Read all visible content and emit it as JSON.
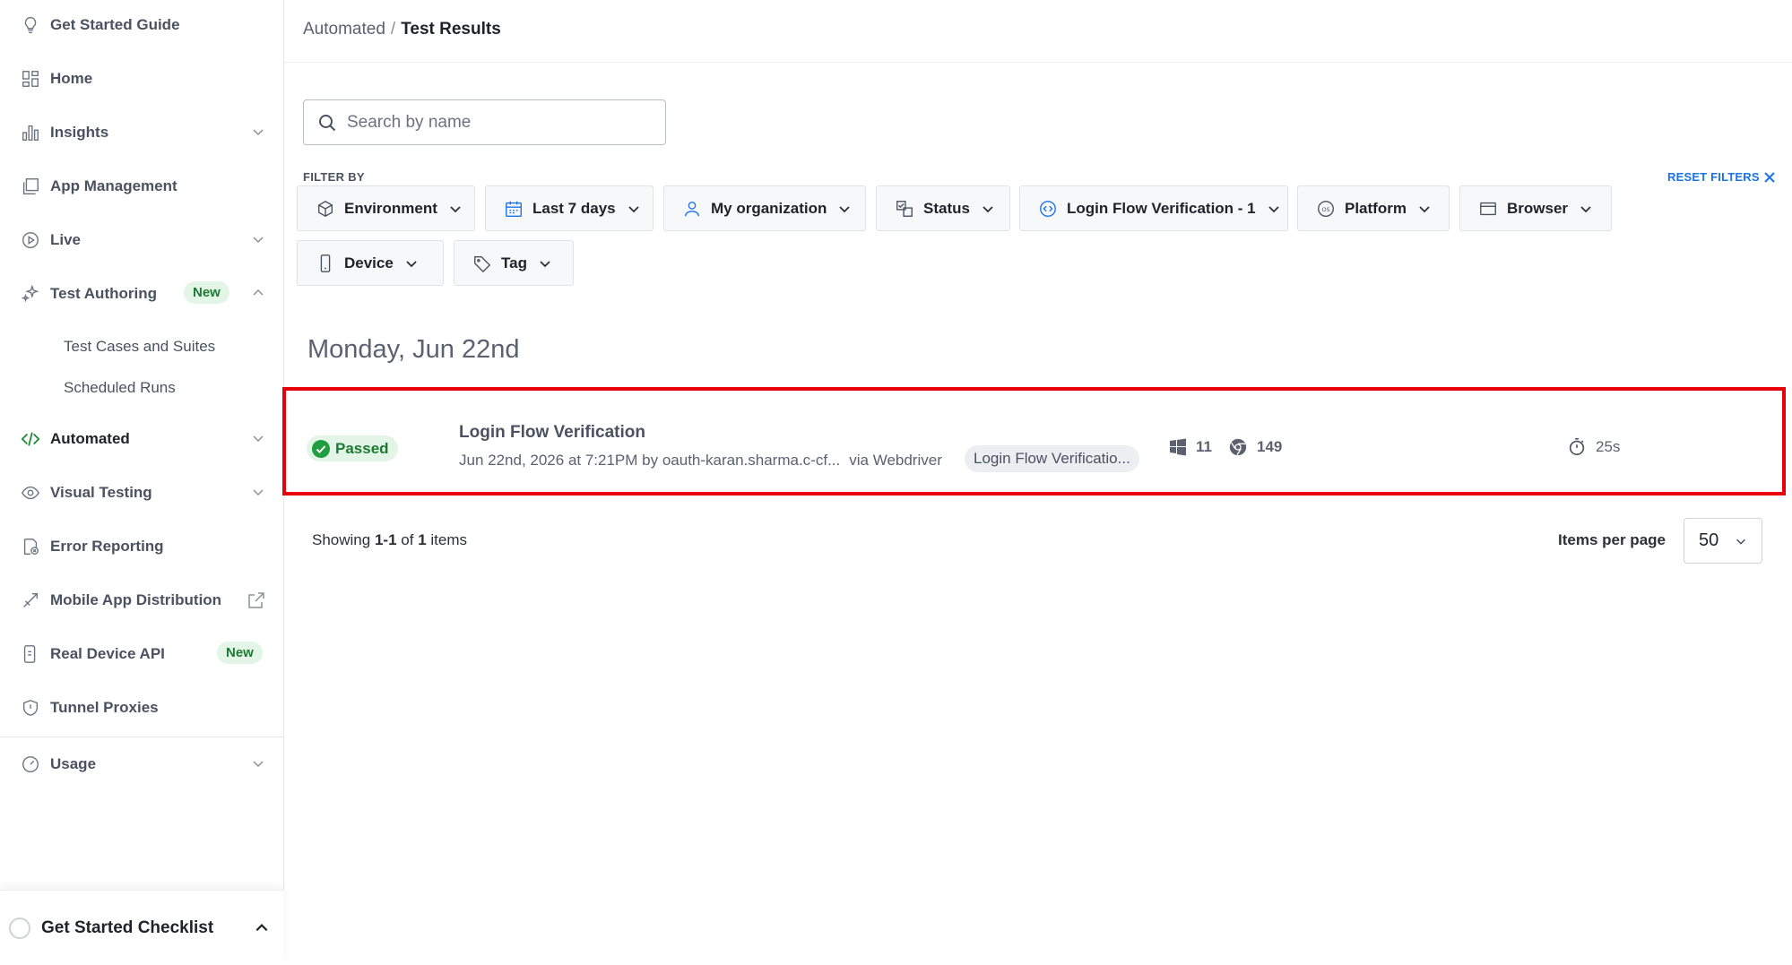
{
  "sidebar": {
    "items": [
      {
        "label": "Get Started Guide",
        "icon": "lightbulb-icon"
      },
      {
        "label": "Home",
        "icon": "dashboard-icon"
      },
      {
        "label": "Insights",
        "icon": "bar-chart-icon"
      },
      {
        "label": "App Management",
        "icon": "app-management-icon"
      },
      {
        "label": "Live",
        "icon": "play-icon"
      },
      {
        "label": "Test Authoring",
        "icon": "sparkle-icon",
        "badge": "New"
      },
      {
        "label": "Automated",
        "icon": "code-icon"
      },
      {
        "label": "Visual Testing",
        "icon": "eye-icon"
      },
      {
        "label": "Error Reporting",
        "icon": "error-report-icon"
      },
      {
        "label": "Mobile App Distribution",
        "icon": "distribution-icon"
      },
      {
        "label": "Real Device API",
        "icon": "device-api-icon",
        "badge": "New"
      },
      {
        "label": "Tunnel Proxies",
        "icon": "shield-icon"
      },
      {
        "label": "Usage",
        "icon": "gauge-icon"
      }
    ],
    "subitems": [
      "Test Cases and Suites",
      "Scheduled Runs"
    ],
    "checklist": "Get Started Checklist"
  },
  "breadcrumb": {
    "parent": "Automated",
    "separator": "/",
    "current": "Test Results"
  },
  "search": {
    "placeholder": "Search by name"
  },
  "filters": {
    "label": "FILTER BY",
    "reset": "RESET FILTERS",
    "buttons": [
      "Environment",
      "Last 7 days",
      "My organization",
      "Status",
      "Login Flow Verification - 1",
      "Platform",
      "Browser",
      "Device",
      "Tag"
    ]
  },
  "group_date": "Monday, Jun 22nd",
  "result": {
    "status": "Passed",
    "title": "Login Flow Verification",
    "meta": "Jun 22nd, 2026 at 7:21PM by oauth-karan.sharma.c-cf...",
    "via": "via Webdriver",
    "tag": "Login Flow Verificatio...",
    "os_version": "11",
    "browser_version": "149",
    "duration": "25s"
  },
  "pagination": {
    "showing_prefix": "Showing",
    "range": "1-1",
    "of": "of",
    "total": "1",
    "items_word": "items",
    "items_per_page_label": "Items per page",
    "items_per_page": "50"
  },
  "colors": {
    "accent_blue": "#1a73e8",
    "passed_green": "#1c7a33",
    "highlight_red": "#e8000b"
  }
}
